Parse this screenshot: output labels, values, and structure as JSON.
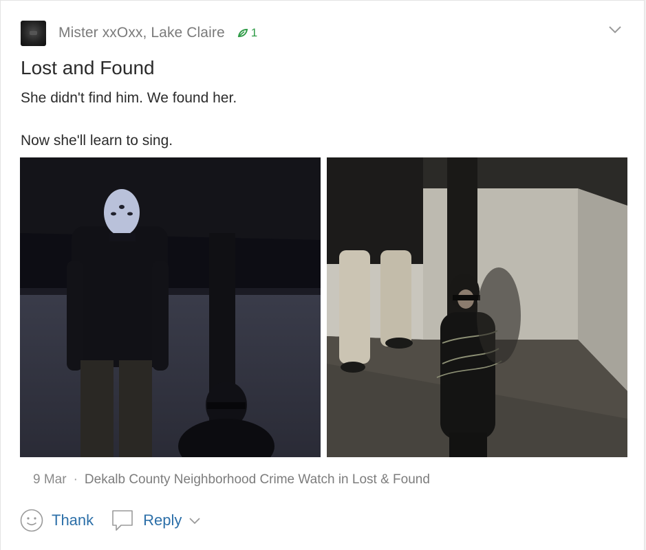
{
  "post": {
    "author": "Mister xxOxx, Lake Claire",
    "leaf_count": "1",
    "title": "Lost and Found",
    "body_lines": [
      "She didn't find him. We found her.",
      "Now she'll learn to sing."
    ],
    "date": "9 Mar",
    "separator": "·",
    "group_text": "Dekalb County Neighborhood Crime Watch in Lost & Found",
    "images": [
      "masked-figure-photo",
      "restrained-person-photo"
    ]
  },
  "actions": {
    "thank_label": "Thank",
    "reply_label": "Reply"
  },
  "icons": {
    "leaf": "leaf-icon",
    "menu": "chevron-down-icon",
    "thank": "smiley-icon",
    "reply": "speech-bubble-icon"
  },
  "colors": {
    "accent_link": "#2c6fa8",
    "leaf_green": "#2e9b46",
    "muted_text": "#7a7a7a",
    "body_text": "#2b2b2b"
  }
}
